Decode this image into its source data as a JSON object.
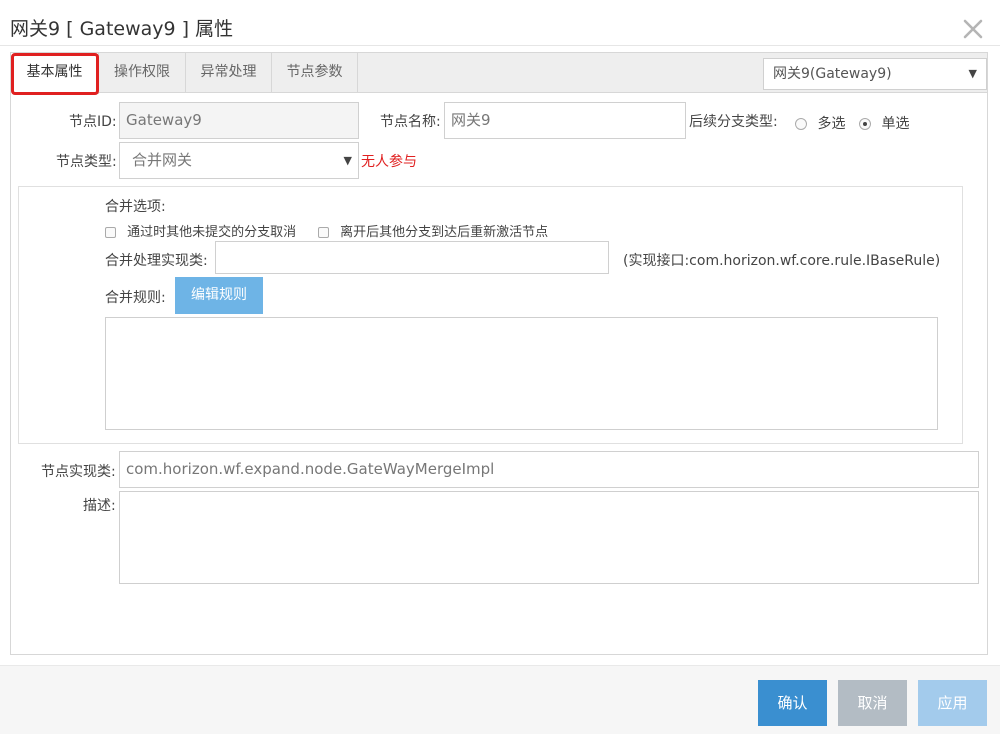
{
  "dialog": {
    "title": "网关9 [ Gateway9 ] 属性"
  },
  "tabs": [
    {
      "label": "基本属性",
      "active": true
    },
    {
      "label": "操作权限",
      "active": false
    },
    {
      "label": "异常处理",
      "active": false
    },
    {
      "label": "节点参数",
      "active": false
    }
  ],
  "node_selector": {
    "value": "网关9(Gateway9)"
  },
  "form": {
    "node_id": {
      "label": "节点ID:",
      "value": "Gateway9"
    },
    "node_name": {
      "label": "节点名称:",
      "value": "网关9"
    },
    "branch_type": {
      "label": "后续分支类型:",
      "options": [
        {
          "label": "多选",
          "checked": false
        },
        {
          "label": "单选",
          "checked": true
        }
      ]
    },
    "node_type": {
      "label": "节点类型:",
      "value": "合并网关",
      "warning": "无人参与"
    },
    "merge": {
      "options_label": "合并选项:",
      "checkboxes": [
        {
          "label": "通过时其他未提交的分支取消",
          "checked": false
        },
        {
          "label": "离开后其他分支到达后重新激活节点",
          "checked": false
        }
      ],
      "impl_class_label": "合并处理实现类:",
      "impl_class_value": "",
      "impl_hint": "(实现接口:com.horizon.wf.core.rule.IBaseRule)",
      "rule_label": "合并规则:",
      "edit_rule_button": "编辑规则",
      "rule_text": ""
    },
    "node_impl": {
      "label": "节点实现类:",
      "value": "com.horizon.wf.expand.node.GateWayMergeImpl"
    },
    "description": {
      "label": "描述:",
      "value": ""
    }
  },
  "footer": {
    "confirm": "确认",
    "cancel": "取消",
    "apply": "应用"
  },
  "colors": {
    "primary": "#3a8fd0",
    "disabled_gray": "#b3bcc4",
    "disabled_blue": "#a3cbec",
    "warning": "#e02020",
    "highlight": "#e02020"
  }
}
